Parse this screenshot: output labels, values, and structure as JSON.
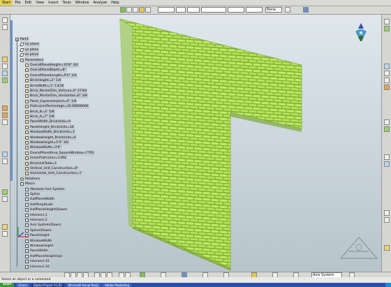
{
  "menu": {
    "items": [
      "Start",
      "File",
      "Edit",
      "View",
      "Insert",
      "Tools",
      "Window",
      "Analyze",
      "Help"
    ]
  },
  "toolbar": {
    "style_combo": "",
    "layer_combo": "",
    "color_combo": "",
    "linetype_combo": "",
    "weight_combo": "None"
  },
  "tree": {
    "nodes": [
      {
        "label": "Part1",
        "icon": "part",
        "depth": 0
      },
      {
        "label": "xy plane",
        "icon": "plane",
        "depth": 1
      },
      {
        "label": "yz plane",
        "icon": "plane",
        "depth": 1
      },
      {
        "label": "zx plane",
        "icon": "plane",
        "depth": 1
      },
      {
        "label": "Parameters",
        "icon": "param",
        "depth": 1
      },
      {
        "label": "OverallPanelHeight=10'8\" 3/4",
        "icon": "param",
        "depth": 2
      },
      {
        "label": "OverallPanelDepth=8\"",
        "icon": "param",
        "depth": 2
      },
      {
        "label": "OverallPanelLength=9'0\" 3/4",
        "icon": "param",
        "depth": 2
      },
      {
        "label": "BrickHeight=2\" 1/4",
        "icon": "param",
        "depth": 2
      },
      {
        "label": "BrickWidth=1\" 13/16",
        "icon": "param",
        "depth": 2
      },
      {
        "label": "Brick_MortarDim_Vertical=0\" 27/64",
        "icon": "param",
        "depth": 2
      },
      {
        "label": "Brick_MortarDim_Horizontal=0\" 3/8",
        "icon": "param",
        "depth": 2
      },
      {
        "label": "Panel_ExpansionJoint=0\" 1/8",
        "icon": "param",
        "depth": 2
      },
      {
        "label": "ProtrusionPercentage=16.66666666",
        "icon": "param",
        "depth": 2
      },
      {
        "label": "Brick_B=3\" 5/8",
        "icon": "param",
        "depth": 2
      },
      {
        "label": "Brick_A=7\" 5/8",
        "icon": "param",
        "depth": 2
      },
      {
        "label": "PanelWidth_BrickUnits=9",
        "icon": "param",
        "depth": 2
      },
      {
        "label": "PanelHeight_BrickUnits=16",
        "icon": "param",
        "depth": 2
      },
      {
        "label": "WindowWidth_BrickUnits=3",
        "icon": "param",
        "depth": 2
      },
      {
        "label": "WindowHeight_BrickUnits=6",
        "icon": "param",
        "depth": 2
      },
      {
        "label": "WindowHeight=5'0\" 3/4",
        "icon": "param",
        "depth": 2
      },
      {
        "label": "WindowWidth=3'8\"",
        "icon": "param",
        "depth": 2
      },
      {
        "label": "OverallPanelArea_SquareWindow=77ft2",
        "icon": "param",
        "depth": 2
      },
      {
        "label": "linearProtrusion=13ft2",
        "icon": "param",
        "depth": 2
      },
      {
        "label": "BrickUnitTotal=1",
        "icon": "param",
        "depth": 2
      },
      {
        "label": "Vertical_Unit_Construction=8\"",
        "icon": "param",
        "depth": 2
      },
      {
        "label": "Horizontal_Unit_Construction=1'",
        "icon": "param",
        "depth": 2
      },
      {
        "label": "Relations",
        "icon": "rel",
        "depth": 1
      },
      {
        "label": "Macro",
        "icon": "part",
        "depth": 1
      },
      {
        "label": "Absolute Axis System",
        "icon": "part",
        "depth": 2
      },
      {
        "label": "Spline",
        "icon": "part",
        "depth": 2
      },
      {
        "label": "HalfPanelWidth",
        "icon": "part",
        "depth": 2
      },
      {
        "label": "HalfAmplitude",
        "icon": "part",
        "depth": 2
      },
      {
        "label": "HalfPanelHeight(Down)",
        "icon": "part",
        "depth": 2
      },
      {
        "label": "Intersect.1",
        "icon": "part",
        "depth": 2
      },
      {
        "label": "Intersect.2",
        "icon": "part",
        "depth": 2
      },
      {
        "label": "Axis System(Down)",
        "icon": "part",
        "depth": 2
      },
      {
        "label": "Spline(Down)",
        "icon": "part",
        "depth": 2
      },
      {
        "label": "PanelHeight",
        "icon": "part",
        "depth": 2
      },
      {
        "label": "WindowWidth",
        "icon": "part",
        "depth": 2
      },
      {
        "label": "WindowHeight",
        "icon": "part",
        "depth": 2
      },
      {
        "label": "PanelWidth",
        "icon": "part",
        "depth": 2
      },
      {
        "label": "HalfPanelHeight(Up)",
        "icon": "part",
        "depth": 2
      },
      {
        "label": "Intersect.15",
        "icon": "part",
        "depth": 2
      },
      {
        "label": "Intersect.16",
        "icon": "part",
        "depth": 2
      }
    ]
  },
  "status": {
    "prompt": "Select an object or a command"
  },
  "bottom_toolbar": {
    "axis_combo": "Axis System"
  },
  "taskbar": {
    "start": "start",
    "tasks": [
      "iTunes",
      "Digital Project V1,R1",
      "Microsoft Visual Basic",
      "Adobe Photoshop"
    ],
    "active_index": 1,
    "tray": ""
  },
  "colors": {
    "brick": "#b9ec5c",
    "brick_shadow": "#6f9a2a",
    "mortar": "#8fb53e",
    "tree_highlight": "#c3cbd2",
    "accent": "#6b8fc8"
  }
}
